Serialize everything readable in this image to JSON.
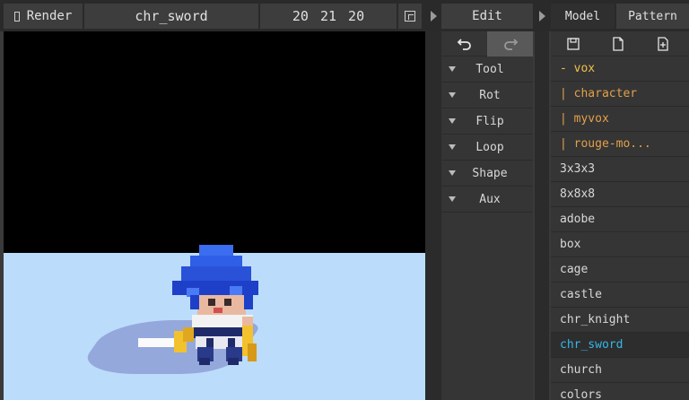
{
  "topbar": {
    "render_label": "Render",
    "model_name": "chr_sword",
    "dimensions": "20 21 20",
    "edit_title": "Edit",
    "tabs": [
      {
        "label": "Model",
        "active": true
      },
      {
        "label": "Pattern",
        "active": false
      }
    ]
  },
  "edit_panel": {
    "undo_icon": "undo-icon",
    "redo_icon": "redo-icon",
    "items": [
      {
        "label": "Tool"
      },
      {
        "label": "Rot"
      },
      {
        "label": "Flip"
      },
      {
        "label": "Loop"
      },
      {
        "label": "Shape"
      },
      {
        "label": "Aux"
      }
    ]
  },
  "model_panel": {
    "file_icons": [
      "save-icon",
      "new-file-icon",
      "add-file-icon"
    ],
    "folders": [
      {
        "label": "- vox"
      },
      {
        "label": "| character"
      },
      {
        "label": "| myvox"
      },
      {
        "label": "| rouge-mo..."
      }
    ],
    "models": [
      {
        "label": "3x3x3"
      },
      {
        "label": "8x8x8"
      },
      {
        "label": "adobe"
      },
      {
        "label": "box"
      },
      {
        "label": "cage"
      },
      {
        "label": "castle"
      },
      {
        "label": "chr_knight"
      },
      {
        "label": "chr_sword",
        "selected": true
      },
      {
        "label": "church"
      },
      {
        "label": "colors"
      }
    ]
  },
  "colors": {
    "accent_selected": "#34b8e8",
    "folder": "#e3a04a",
    "floor": "#bcdcfb",
    "viewport_bg": "#000000"
  }
}
